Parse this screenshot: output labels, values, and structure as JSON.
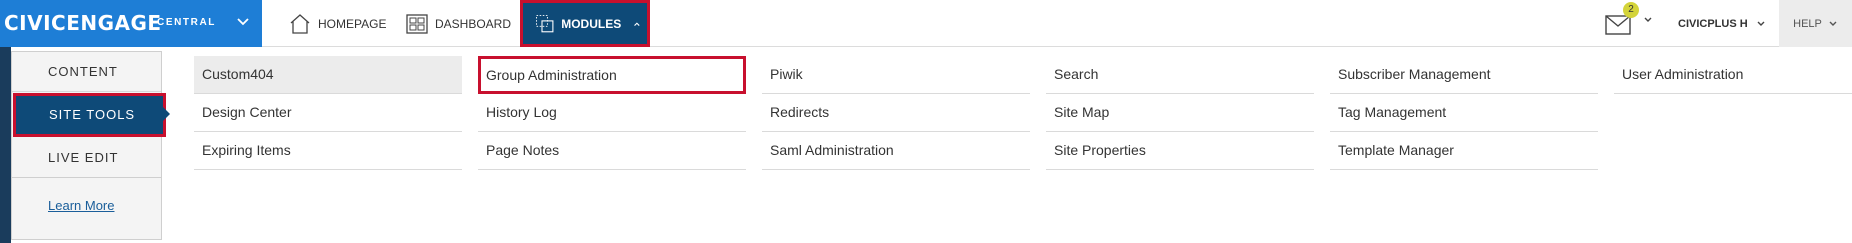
{
  "brand": {
    "name": "CIVICENGAGE",
    "sub": "CENTRAL"
  },
  "nav": {
    "home": "HOMEPAGE",
    "dashboard": "DASHBOARD",
    "modules": "MODULES"
  },
  "mail": {
    "badge": "2",
    "icon": "mail-icon"
  },
  "user": {
    "name": "CIVICPLUS H"
  },
  "help": {
    "label": "HELP"
  },
  "side": {
    "content": "CONTENT",
    "site_tools": "SITE TOOLS",
    "live_edit": "LIVE EDIT",
    "learn_more": "Learn More"
  },
  "modules": {
    "col1": [
      "Custom404",
      "Design Center",
      "Expiring Items"
    ],
    "col2": [
      "Group Administration",
      "History Log",
      "Page Notes"
    ],
    "col3": [
      "Piwik",
      "Redirects",
      "Saml Administration"
    ],
    "col4": [
      "Search",
      "Site Map",
      "Site Properties"
    ],
    "col5": [
      "Subscriber Management",
      "Tag Management",
      "Template Manager"
    ],
    "col6": [
      "User Administration"
    ]
  },
  "colors": {
    "brand_blue": "#1e7ed6",
    "active_navy": "#0e4a78",
    "highlight_red": "#c8102e",
    "badge_yellow": "#d4d43a"
  }
}
